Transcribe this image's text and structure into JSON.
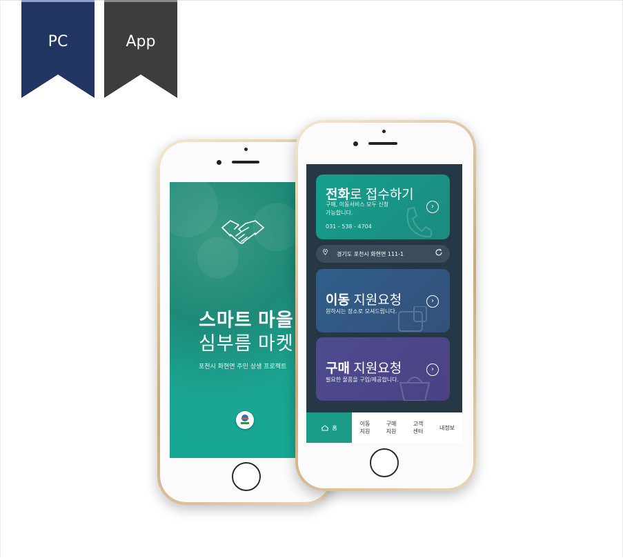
{
  "tabs": {
    "pc": "PC",
    "app": "App"
  },
  "colors": {
    "pc_ribbon": "#213563",
    "app_ribbon": "#3d3d3d",
    "splash_bg": "#1aa592",
    "front_bg": "#263845",
    "card_phone": "#14a08d",
    "card_move": "#2f5f8b",
    "card_buy": "#4e4b8f"
  },
  "splash": {
    "title": "스마트 마을",
    "subtitle": "심부름 마켓",
    "description": "포천시 화현면 주민 상생 프로젝트",
    "logo_icon": "handshake-icon"
  },
  "app": {
    "card_phone": {
      "title_bold": "전화",
      "title_rest": "로 접수하기",
      "line1": "구매, 이동서비스 모두 신청",
      "line2": "가능합니다.",
      "phone": "031 - 538 - 4704"
    },
    "address": "경기도 포천시 화현면 111-1",
    "card_move": {
      "title_bold": "이동",
      "title_rest": " 지원요청",
      "desc": "원하시는 장소로 모셔드립니다."
    },
    "card_buy": {
      "title_bold": "구매",
      "title_rest": " 지원요청",
      "desc": "필요한 물품을 구입/제공합니다."
    },
    "tabbar": {
      "home": "홈",
      "move_l1": "이동",
      "move_l2": "지원",
      "buy_l1": "구매",
      "buy_l2": "지원",
      "cs_l1": "고객",
      "cs_l2": "센터",
      "my": "내정보"
    }
  }
}
